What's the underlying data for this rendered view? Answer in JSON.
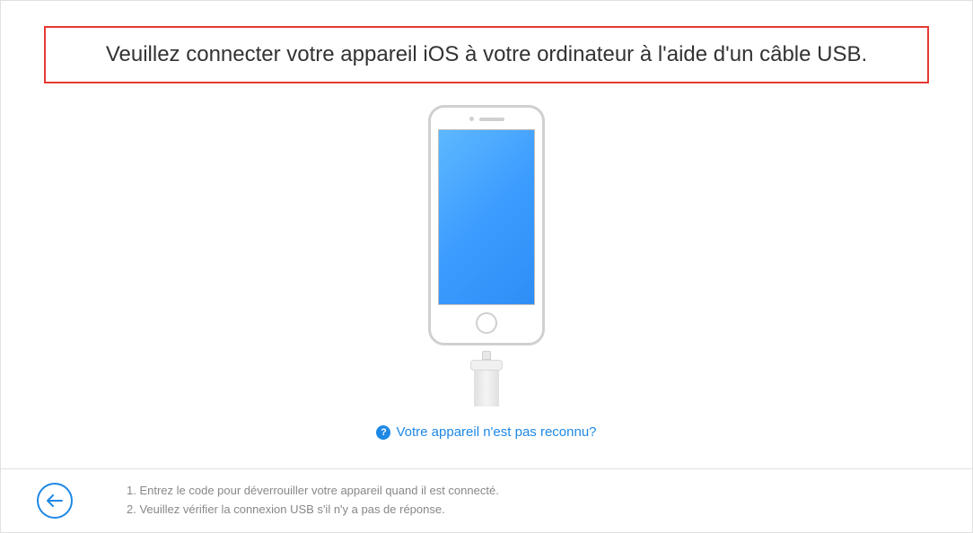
{
  "title": "Veuillez connecter votre appareil iOS à votre ordinateur à l'aide d'un câble USB.",
  "helpLink": "Votre appareil n'est pas reconnu?",
  "tips": {
    "line1": "1. Entrez le code pour déverrouiller votre appareil quand il est connecté.",
    "line2": "2. Veuillez vérifier la connexion USB s'il n'y a pas de réponse."
  }
}
